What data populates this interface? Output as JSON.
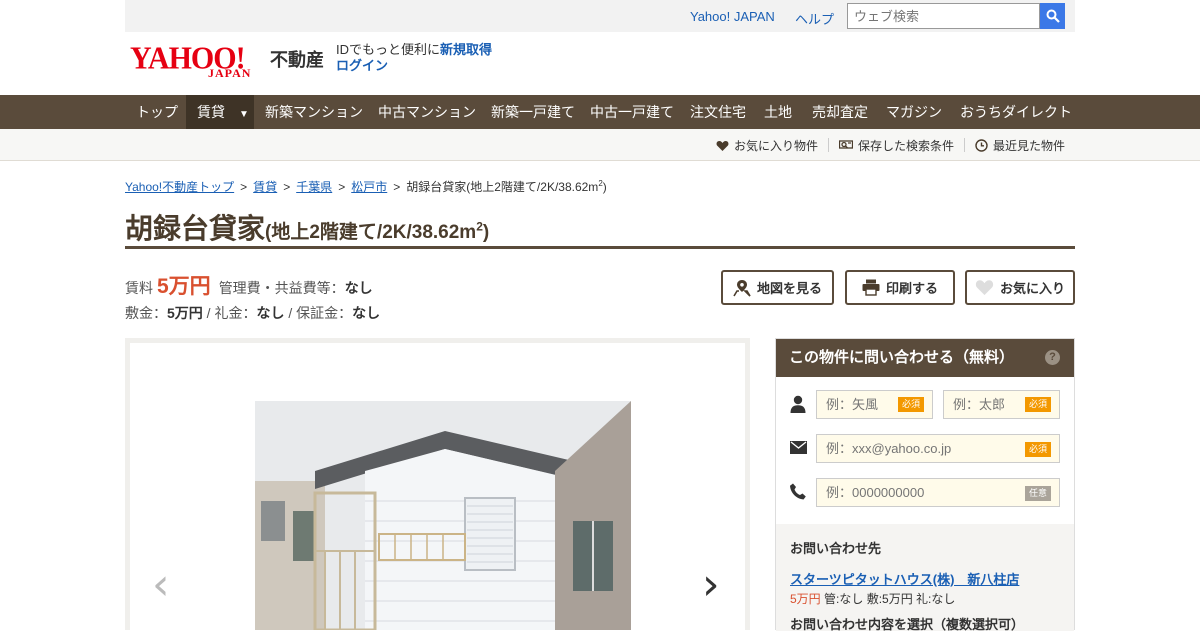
{
  "util": {
    "yahoo_japan": "Yahoo! JAPAN",
    "help": "ヘルプ",
    "search_placeholder": "ウェブ検索"
  },
  "logo": {
    "yahoo": "YAHOO!",
    "japan": "JAPAN",
    "service": "不動産"
  },
  "account": {
    "prompt": "IDでもっと便利に",
    "signup": "新規取得",
    "login": "ログイン"
  },
  "nav": {
    "items": [
      {
        "label": "トップ"
      },
      {
        "label": "賃貸"
      },
      {
        "label": "新築マンション"
      },
      {
        "label": "中古マンション"
      },
      {
        "label": "新築一戸建て"
      },
      {
        "label": "中古一戸建て"
      },
      {
        "label": "注文住宅"
      },
      {
        "label": "土地"
      },
      {
        "label": "売却査定"
      },
      {
        "label": "マガジン"
      },
      {
        "label": "おうちダイレクト"
      }
    ],
    "caret": "▼"
  },
  "subnav": {
    "favorites": "お気に入り物件",
    "saved_search": "保存した検索条件",
    "recent": "最近見た物件"
  },
  "breadcrumb": {
    "items": [
      "Yahoo!不動産トップ",
      "賃貸",
      "千葉県",
      "松戸市"
    ],
    "current": "胡録台貸家(地上2階建て/2K/38.62m",
    "current_sup": "2",
    "current_end": ")",
    "separator": ">"
  },
  "title": {
    "name": "胡録台貸家",
    "detail": "(地上2階建て/2K/38.62m",
    "sup": "2",
    "end": ")"
  },
  "price": {
    "rent_label": "賃料",
    "rent": "5万円",
    "fee_label": "管理費・共益費等：",
    "fee": "なし",
    "deposit_label": "敷金：",
    "deposit": "5万円",
    "key_money_label": " / 礼金：",
    "key_money": "なし",
    "guarantee_label": " / 保証金：",
    "guarantee": "なし"
  },
  "actions": {
    "map": "地図を見る",
    "print": "印刷する",
    "favorite": "お気に入り"
  },
  "gallery": {
    "prev": "‹",
    "next": "›"
  },
  "form": {
    "title": "この物件に問い合わせる（無料）",
    "help": "?",
    "last_name_placeholder": "例：矢風",
    "first_name_placeholder": "例：太郎",
    "email_placeholder": "例：xxx@yahoo.co.jp",
    "phone_placeholder": "例：0000000000",
    "required": "必須",
    "optional": "任意"
  },
  "contact": {
    "title": "お問い合わせ先",
    "shop": "スターツピタットハウス(株)　新八柱店",
    "rent": "5万円",
    "info": " 管:なし 敷:5万円 礼:なし",
    "select_label": "お問い合わせ内容を選択（複数選択可）"
  },
  "colors": {
    "brand_brown": "#5a4b3b",
    "accent_red": "#d9502f",
    "link_blue": "#1a5fb4",
    "required_orange": "#f39800"
  }
}
